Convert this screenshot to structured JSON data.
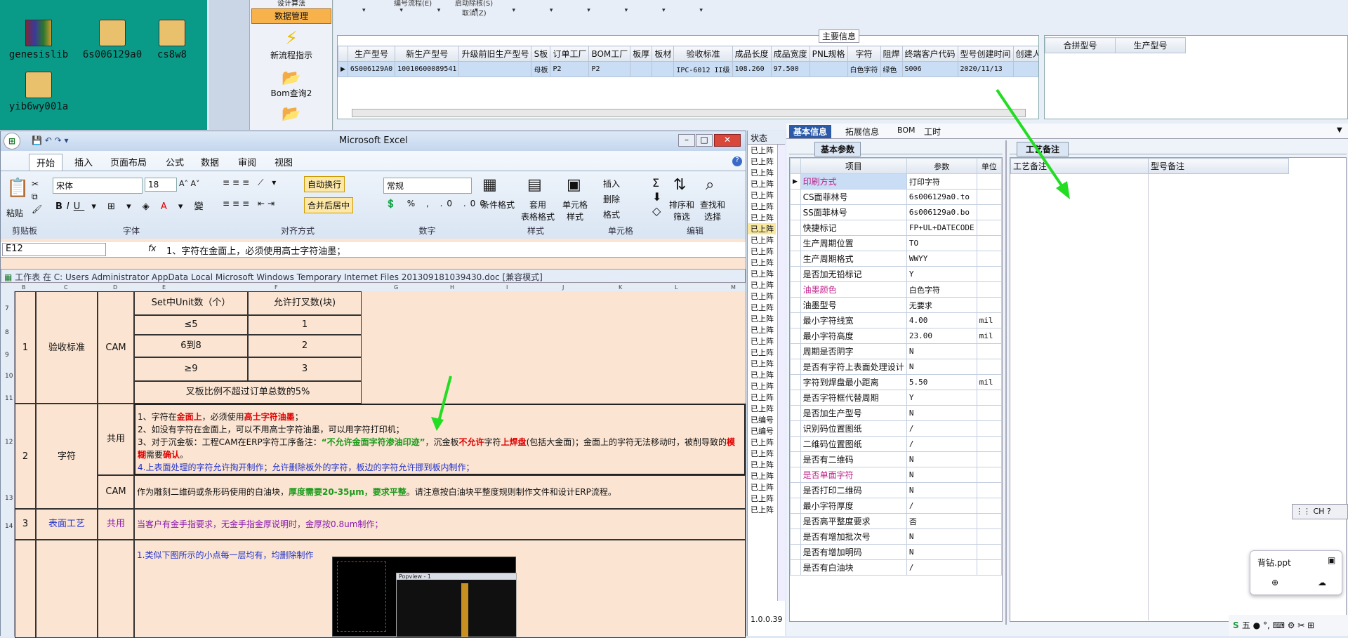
{
  "desktop": {
    "icons": [
      {
        "label": "genesislib"
      },
      {
        "label": "6s006129a0"
      },
      {
        "label": "cs8w8"
      },
      {
        "label": "yib6wy001a"
      }
    ]
  },
  "launcher": {
    "items": [
      "设计算法",
      "数据管理",
      "新流程指示",
      "Bom查询2"
    ]
  },
  "erp": {
    "dropdowns": [
      "编号流程(E)",
      "启动除核(S)",
      "取消(Z)"
    ],
    "main_panel_title": "主要信息",
    "columns": [
      "生产型号",
      "新生产型号",
      "升级前旧生产型号",
      "S板",
      "订单工厂",
      "BOM工厂",
      "板厚",
      "板材",
      "验收标准",
      "成品长度",
      "成品宽度",
      "PNL规格",
      "字符",
      "阻焊",
      "终端客户代码",
      "型号创建时间",
      "创建人"
    ],
    "row": [
      "6S006129A0",
      "10010600089541",
      "",
      "母板",
      "P2",
      "P2",
      "",
      "",
      "IPC-6012 II级",
      "108.260",
      "97.500",
      "",
      "白色字符",
      "绿色",
      "S006",
      "2020/11/13",
      ""
    ],
    "right_columns": [
      "合拼型号",
      "生产型号"
    ]
  },
  "excel": {
    "title": "Microsoft Excel",
    "tabs": [
      "开始",
      "插入",
      "页面布局",
      "公式",
      "数据",
      "审阅",
      "视图"
    ],
    "font_name": "宋体",
    "font_size": "18",
    "number_format": "常规",
    "buttons": {
      "paste": "粘贴",
      "wrap": "自动换行",
      "merge": "合并后居中",
      "cond": "条件格式",
      "table": "套用\n表格格式",
      "cellstyle": "单元格\n样式",
      "insert": "插入",
      "delete": "删除",
      "format": "格式",
      "sort": "排序和\n筛选",
      "find": "查找和\n选择"
    },
    "groups": [
      "剪贴板",
      "字体",
      "对齐方式",
      "数字",
      "样式",
      "单元格",
      "编辑"
    ],
    "cell_ref": "E12",
    "formula": "1、字符在金面上，必须使用高士字符油墨；",
    "sheet_title": "工作表 在 C: Users Administrator AppData Local Microsoft Windows Temporary Internet Files 201309181039430.doc  [兼容模式]",
    "col_letters": [
      "B",
      "C",
      "D",
      "E",
      "F",
      "G",
      "H",
      "I",
      "J",
      "K",
      "L",
      "M"
    ],
    "row_nums": [
      "7",
      "8",
      "9",
      "10",
      "11",
      "12",
      "13",
      "14"
    ],
    "rows": {
      "r1": {
        "num": "1",
        "name": "验收标准",
        "dept": "CAM",
        "t_h1": "Set中Unit数（个）",
        "t_h2": "允许打叉数(块)",
        "t": [
          [
            "≤5",
            "1"
          ],
          [
            "6到8",
            "2"
          ],
          [
            "≥9",
            "3"
          ]
        ],
        "note": "叉板比例不超过订单总数的5%"
      },
      "r2": {
        "num": "2",
        "name": "字符",
        "dept1": "共用",
        "dept2": "CAM",
        "l1a": "1、字符在",
        "l1b": "金面上",
        "l1c": "，必须使用",
        "l1d": "高士字符油墨",
        "l1e": "；",
        "l2": "2、如没有字符在金面上，可以不用高士字符油墨，可以用字符打印机；",
        "l3a": "3、对于沉金板：工程CAM在ERP字符工序备注：",
        "l3b": "“不允许金面字符渗油印迹”",
        "l3c": "，沉金板",
        "l3d": "不允许",
        "l3e": "字符",
        "l3f": "上焊盘",
        "l3g": "(包括大金面)；金面上的字符无法移动时，被削导致的",
        "l3h": "模糊",
        "l3i": "需要",
        "l3j": "确认",
        "l3k": "。",
        "l4": "4.上表面处理的字符允许掏开制作；允许删除板外的字符，板边的字符允许挪到板内制作；",
        "cam_a": "作为雕刻二维码或条形码使用的白油块，",
        "cam_b": "厚度需要20-35μm，要求平整",
        "cam_c": "。请注意按白油块平整度规则制作文件和设计ERP流程。"
      },
      "r3": {
        "num": "3",
        "name": "表面工艺",
        "dept": "共用",
        "text": "当客户有金手指要求，无金手指金厚说明时，金厚按0.8um制作；"
      },
      "r4": {
        "text": "1.类似下图所示的小点每一层均有，均删除制作",
        "popup": "Popview - 1"
      }
    }
  },
  "status_col": {
    "header": "状态",
    "items": [
      "已上阵",
      "已上阵",
      "已上阵",
      "已上阵",
      "已上阵",
      "已上阵",
      "已上阵",
      "已上阵",
      "已上阵",
      "已上阵",
      "已上阵",
      "已上阵",
      "已上阵",
      "已上阵",
      "已上阵",
      "已上阵",
      "已上阵",
      "已上阵",
      "已上阵",
      "已上阵",
      "已上阵",
      "已上阵",
      "已上阵",
      "已上阵",
      "已编号",
      "已编号",
      "已上阵",
      "已上阵",
      "已上阵",
      "已上阵",
      "已上阵",
      "已上阵",
      "已上阵"
    ],
    "version": "1.0.0.39"
  },
  "detail": {
    "tabs": [
      "基本信息",
      "拓展信息",
      "BOM",
      "工时"
    ],
    "subtab": "基本参数",
    "headers": [
      "项目",
      "参数",
      "单位"
    ],
    "params": [
      [
        "印刷方式",
        "打印字符",
        ""
      ],
      [
        "CS面菲林号",
        "6s006129a0.to",
        ""
      ],
      [
        "SS面菲林号",
        "6s006129a0.bo",
        ""
      ],
      [
        "快捷标记",
        "FP+UL+DATECODE",
        ""
      ],
      [
        "生产周期位置",
        "TO",
        ""
      ],
      [
        "生产周期格式",
        "WWYY",
        ""
      ],
      [
        "是否加无铅标记",
        "Y",
        ""
      ],
      [
        "油墨颜色",
        "白色字符",
        ""
      ],
      [
        "油墨型号",
        "无要求",
        ""
      ],
      [
        "最小字符线宽",
        "4.00",
        "mil"
      ],
      [
        "最小字符高度",
        "23.00",
        "mil"
      ],
      [
        "周期是否阴字",
        "N",
        ""
      ],
      [
        "是否有字符上表面处理设计",
        "N",
        ""
      ],
      [
        "字符到焊盘最小距离",
        "5.50",
        "mil"
      ],
      [
        "是否字符框代替周期",
        "Y",
        ""
      ],
      [
        "是否加生产型号",
        "N",
        ""
      ],
      [
        "识别码位置图纸",
        "/",
        ""
      ],
      [
        "二维码位置图纸",
        "/",
        ""
      ],
      [
        "是否有二维码",
        "N",
        ""
      ],
      [
        "是否单面字符",
        "N",
        ""
      ],
      [
        "是否打印二维码",
        "N",
        ""
      ],
      [
        "最小字符厚度",
        "/",
        ""
      ],
      [
        "是否高平整度要求",
        "否",
        ""
      ],
      [
        "是否有增加批次号",
        "N",
        ""
      ],
      [
        "是否有增加明码",
        "N",
        ""
      ],
      [
        "是否有白油块",
        "/",
        ""
      ]
    ],
    "pink_rows": [
      0,
      7,
      19
    ],
    "remarks_tab": "工艺备注",
    "remarks_headers": [
      "工艺备注",
      "型号备注"
    ]
  },
  "taskbar": {
    "ime": "CH",
    "file_popup": "背钻.ppt",
    "tray": "五"
  }
}
